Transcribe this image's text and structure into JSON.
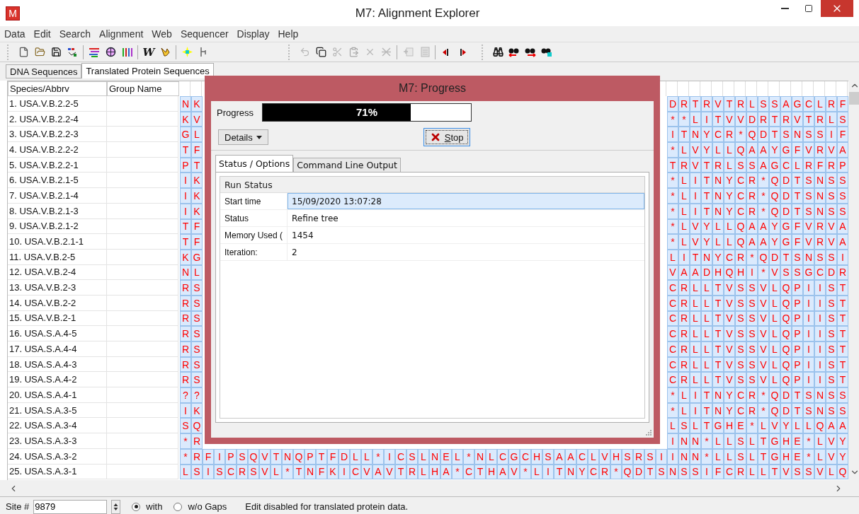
{
  "window": {
    "title": "M7: Alignment Explorer",
    "app_icon": "M"
  },
  "menu": [
    "Data",
    "Edit",
    "Search",
    "Alignment",
    "Web",
    "Sequencer",
    "Display",
    "Help"
  ],
  "toolbar": {
    "bands": [
      {
        "groups": [
          [
            {
              "kind": "new",
              "disabled": false
            },
            {
              "kind": "open",
              "disabled": false
            },
            {
              "kind": "save",
              "disabled": false
            },
            {
              "kind": "translate",
              "disabled": false
            }
          ],
          [
            {
              "kind": "lines",
              "disabled": false
            },
            {
              "kind": "query",
              "disabled": false
            },
            {
              "kind": "bars",
              "disabled": false
            }
          ],
          [
            {
              "kind": "letter",
              "label": "W",
              "disabled": false
            },
            {
              "kind": "muscle",
              "disabled": false
            }
          ],
          [
            {
              "kind": "star",
              "disabled": false
            },
            {
              "kind": "tool",
              "disabled": false
            }
          ]
        ]
      },
      {
        "groups": [
          [
            {
              "kind": "undo",
              "disabled": true
            },
            {
              "kind": "copy",
              "disabled": false
            },
            {
              "kind": "cut",
              "disabled": true
            },
            {
              "kind": "paste",
              "disabled": true
            },
            {
              "kind": "delete",
              "disabled": true
            },
            {
              "kind": "delete-gap",
              "disabled": true
            }
          ],
          [
            {
              "kind": "insert",
              "disabled": true
            },
            {
              "kind": "insert-block",
              "disabled": true
            }
          ],
          [
            {
              "kind": "prev",
              "disabled": false
            },
            {
              "kind": "next",
              "disabled": false
            }
          ]
        ]
      },
      {
        "groups": [
          [
            {
              "kind": "find",
              "disabled": false
            },
            {
              "kind": "find-prev",
              "disabled": false
            },
            {
              "kind": "find-next",
              "disabled": false
            },
            {
              "kind": "find-mark",
              "disabled": false
            }
          ]
        ]
      }
    ]
  },
  "tabs": [
    {
      "label": "DNA Sequences",
      "selected": false
    },
    {
      "label": "Translated Protein Sequences",
      "selected": true
    }
  ],
  "table": {
    "columns": [
      "Species/Abbrv",
      "Group Name"
    ],
    "rows": [
      {
        "name": "1. USA.V.B.2.2-5",
        "left": "N K",
        "right": "D R T R V T R L S S A G C L R F"
      },
      {
        "name": "2. USA.V.B.2.2-4",
        "left": "K V",
        "right": "* * L I T V V D R T R V T R L S"
      },
      {
        "name": "3. USA.V.B.2.2-3",
        "left": "G L",
        "right": "I T N Y C R * Q D T S N S S I F"
      },
      {
        "name": "4. USA.V.B.2.2-2",
        "left": "T F",
        "right": "* L V Y L L Q A A Y G F V R V A"
      },
      {
        "name": "5. USA.V.B.2.2-1",
        "left": "P T",
        "right": "T R V T R L S S A G C L R F R P"
      },
      {
        "name": "6. USA.V.B.2.1-5",
        "left": "I K",
        "right": "* L I T N Y C R * Q D T S N S S"
      },
      {
        "name": "7. USA.V.B.2.1-4",
        "left": "I K",
        "right": "* L I T N Y C R * Q D T S N S S"
      },
      {
        "name": "8. USA.V.B.2.1-3",
        "left": "I K",
        "right": "* L I T N Y C R * Q D T S N S S"
      },
      {
        "name": "9. USA.V.B.2.1-2",
        "left": "T F",
        "right": "* L V Y L L Q A A Y G F V R V A"
      },
      {
        "name": "10. USA.V.B.2.1-1",
        "left": "T F",
        "right": "* L V Y L L Q A A Y G F V R V A"
      },
      {
        "name": "11. USA.V.B.2-5",
        "left": "K G",
        "right": "L I T N Y C R * Q D T S N S S I"
      },
      {
        "name": "12. USA.V.B.2-4",
        "left": "N L",
        "right": "V A A D H Q H I * V S S G C D R"
      },
      {
        "name": "13. USA.V.B.2-3",
        "left": "R S",
        "right": "C R L L T V S S V L Q P I I S T"
      },
      {
        "name": "14. USA.V.B.2-2",
        "left": "R S",
        "right": "C R L L T V S S V L Q P I I S T"
      },
      {
        "name": "15. USA.V.B.2-1",
        "left": "R S",
        "right": "C R L L T V S S V L Q P I I S T"
      },
      {
        "name": "16. USA.S.A.4-5",
        "left": "R S",
        "right": "C R L L T V S S V L Q P I I S T"
      },
      {
        "name": "17. USA.S.A.4-4",
        "left": "R S",
        "right": "C R L L T V S S V L Q P I I S T"
      },
      {
        "name": "18. USA.S.A.4-3",
        "left": "R S",
        "right": "C R L L T V S S V L Q P I I S T"
      },
      {
        "name": "19. USA.S.A.4-2",
        "left": "R S",
        "right": "C R L L T V S S V L Q P I I S T"
      },
      {
        "name": "20. USA.S.A.4-1",
        "left": "? ?",
        "right": "* L I T N Y C R * Q D T S N S S"
      },
      {
        "name": "21. USA.S.A.3-5",
        "left": "I K",
        "right": "* L I T N Y C R * Q D T S N S S"
      },
      {
        "name": "22. USA.S.A.3-4",
        "left": "S Q",
        "right": "L S L T G H E * L V Y L L Q A A"
      },
      {
        "name": "23. USA.S.A.3-3",
        "left": "* R",
        "right": "I N N * L L S L T G H E * L V Y"
      },
      {
        "name": "24. USA.S.A.3-2",
        "residues": "* R F I P S Q V T N Q P T F D L L * I C S L N E L * N L C G C H S A A C L V H S R S I I N N * L L S L T G H E * L V Y"
      },
      {
        "name": "25. USA.S.A.3-1",
        "residues": "L S I S C R S V L * T N F K I C V A V T R L H A * C T H A V * L I T N Y C R * Q D T S N S S I F C R L L T V S S V L Q"
      }
    ]
  },
  "status_bar": {
    "site_label": "Site #",
    "site_value": "9879",
    "gap_options": [
      {
        "label": "with",
        "selected": true
      },
      {
        "label": "w/o Gaps",
        "selected": false
      }
    ],
    "message": "Edit disabled for translated protein data."
  },
  "dialog": {
    "title": "M7: Progress",
    "progress_label": "Progress",
    "progress": {
      "level": 0.71,
      "reading": "71%"
    },
    "details_button": "Details",
    "stop_button": "Stop",
    "tabs": [
      {
        "label": "Status / Options",
        "selected": true
      },
      {
        "label": "Command Line Output",
        "selected": false
      }
    ],
    "group_title": "Run Status",
    "rows": [
      {
        "label": "Start time",
        "value": "15/09/2020 13:07:28",
        "selected": true
      },
      {
        "label": "Status",
        "value": "Refine tree",
        "selected": false
      },
      {
        "label": "Memory Used (",
        "value": "1454",
        "selected": false
      },
      {
        "label": "Iteration:",
        "value": "2",
        "selected": false
      }
    ]
  }
}
